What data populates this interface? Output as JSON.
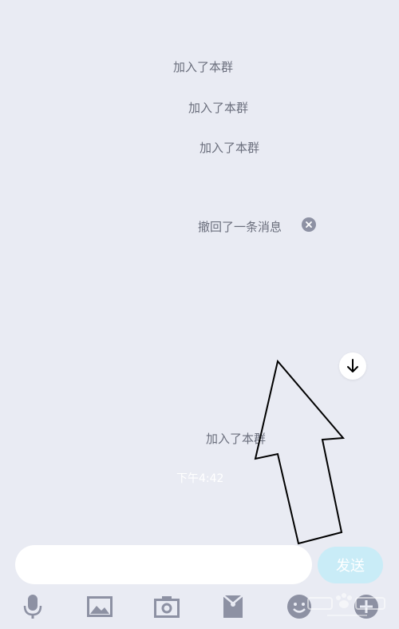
{
  "chat": {
    "messages": [
      {
        "text": "加入了本群"
      },
      {
        "text": "加入了本群"
      },
      {
        "text": "加入了本群"
      }
    ],
    "recall_notice": "撤回了一条消息",
    "late_join": "加入了本群",
    "timestamp": "下午4:42"
  },
  "composer": {
    "input_value": "",
    "send_label": "发送"
  },
  "toolbar": {
    "icons": [
      "microphone-icon",
      "image-icon",
      "camera-icon",
      "red-packet-icon",
      "emoji-icon",
      "plus-icon"
    ]
  },
  "colors": {
    "background": "#e9ebf3",
    "send_disabled": "#c9ecf7",
    "icon": "#8d91a3"
  }
}
